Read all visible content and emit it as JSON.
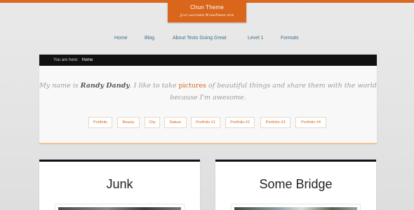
{
  "site": {
    "title": "Chun Theme",
    "tagline": "Just another WordPress site"
  },
  "nav": {
    "items": [
      "Home",
      "Blog",
      "About Tests Going Great",
      "Level 1",
      "Formats"
    ]
  },
  "breadcrumb": {
    "prefix": "You are here:",
    "current": "Home"
  },
  "intro": {
    "part1": "My name is ",
    "name": "Randy Dandy",
    "part2": ". I like to take ",
    "highlight": "pictures",
    "part3": " of beautiful things and share them with the world because I'm awesome."
  },
  "tags": [
    "Portfolio",
    "Beauty",
    "City",
    "Nature",
    "Portfolio #1",
    "Portfolio #2",
    "Portfolio #3",
    "Portfolio #4"
  ],
  "cards": [
    {
      "title": "Junk"
    },
    {
      "title": "Some Bridge"
    }
  ],
  "colors": {
    "accent": "#d9661b",
    "nav_link": "#3e6f88",
    "breadcrumb_bg": "#111111"
  }
}
